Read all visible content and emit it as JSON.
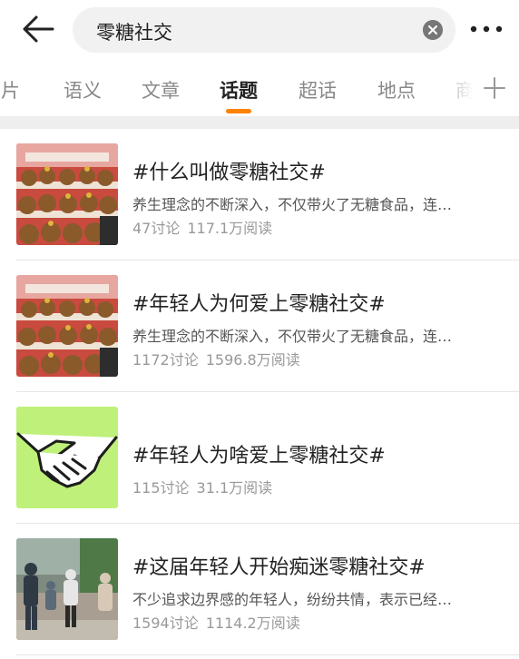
{
  "search": {
    "query": "零糖社交"
  },
  "tabs": [
    {
      "label": "图片"
    },
    {
      "label": "语义"
    },
    {
      "label": "文章"
    },
    {
      "label": "话题",
      "active": true
    },
    {
      "label": "超话"
    },
    {
      "label": "地点"
    },
    {
      "label": "商"
    }
  ],
  "topics": [
    {
      "title": "#什么叫做零糖社交#",
      "desc": "养生理念的不断深入，不仅带火了无糖食品，连…",
      "discussions": "47讨论",
      "reads": "117.1万阅读",
      "thumb": "plush-toys"
    },
    {
      "title": "#年轻人为何爱上零糖社交#",
      "desc": "养生理念的不断深入，不仅带火了无糖食品，连…",
      "discussions": "1172讨论",
      "reads": "1596.8万阅读",
      "thumb": "plush-toys"
    },
    {
      "title": "#年轻人为啥爱上零糖社交#",
      "desc": "",
      "discussions": "115讨论",
      "reads": "31.1万阅读",
      "thumb": "handshake"
    },
    {
      "title": "#这届年轻人开始痴迷零糖社交#",
      "desc": "不少追求边界感的年轻人，纷纷共情，表示已经…",
      "discussions": "1594讨论",
      "reads": "1114.2万阅读",
      "thumb": "people-photo"
    }
  ],
  "colors": {
    "accent": "#ff8200",
    "handshake_bg": "#bff07a"
  }
}
